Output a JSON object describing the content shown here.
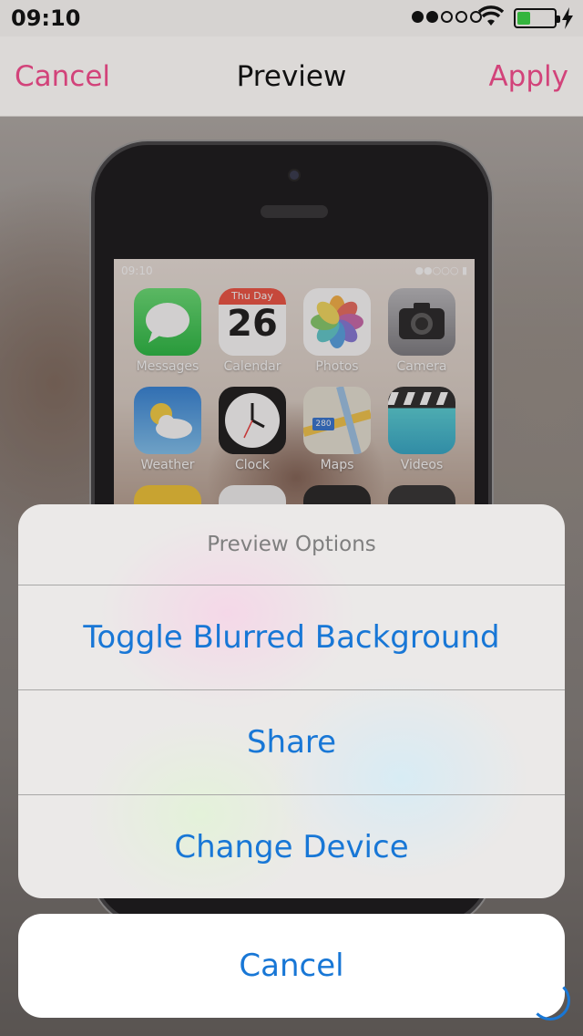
{
  "status_bar": {
    "time": "09:10",
    "signal_full": 2,
    "signal_total": 5,
    "battery_level": 0.35,
    "battery_color": "#35b53e"
  },
  "nav": {
    "cancel": "Cancel",
    "title": "Preview",
    "apply": "Apply",
    "accent_color": "#d2437a"
  },
  "preview_phone": {
    "status_time": "09:10",
    "apps": [
      {
        "label": "Messages",
        "icon": "messages-icon"
      },
      {
        "label": "Calendar",
        "icon": "calendar-icon",
        "day_name": "Thu Day",
        "day_number": "26"
      },
      {
        "label": "Photos",
        "icon": "photos-icon"
      },
      {
        "label": "Camera",
        "icon": "camera-icon"
      },
      {
        "label": "Weather",
        "icon": "weather-icon"
      },
      {
        "label": "Clock",
        "icon": "clock-icon"
      },
      {
        "label": "Maps",
        "icon": "maps-icon",
        "badge": "280"
      },
      {
        "label": "Videos",
        "icon": "videos-icon"
      }
    ]
  },
  "action_sheet": {
    "title": "Preview Options",
    "options": [
      {
        "label": "Toggle Blurred Background"
      },
      {
        "label": "Share"
      },
      {
        "label": "Change Device"
      }
    ],
    "cancel": "Cancel",
    "button_color": "#1877d6"
  }
}
